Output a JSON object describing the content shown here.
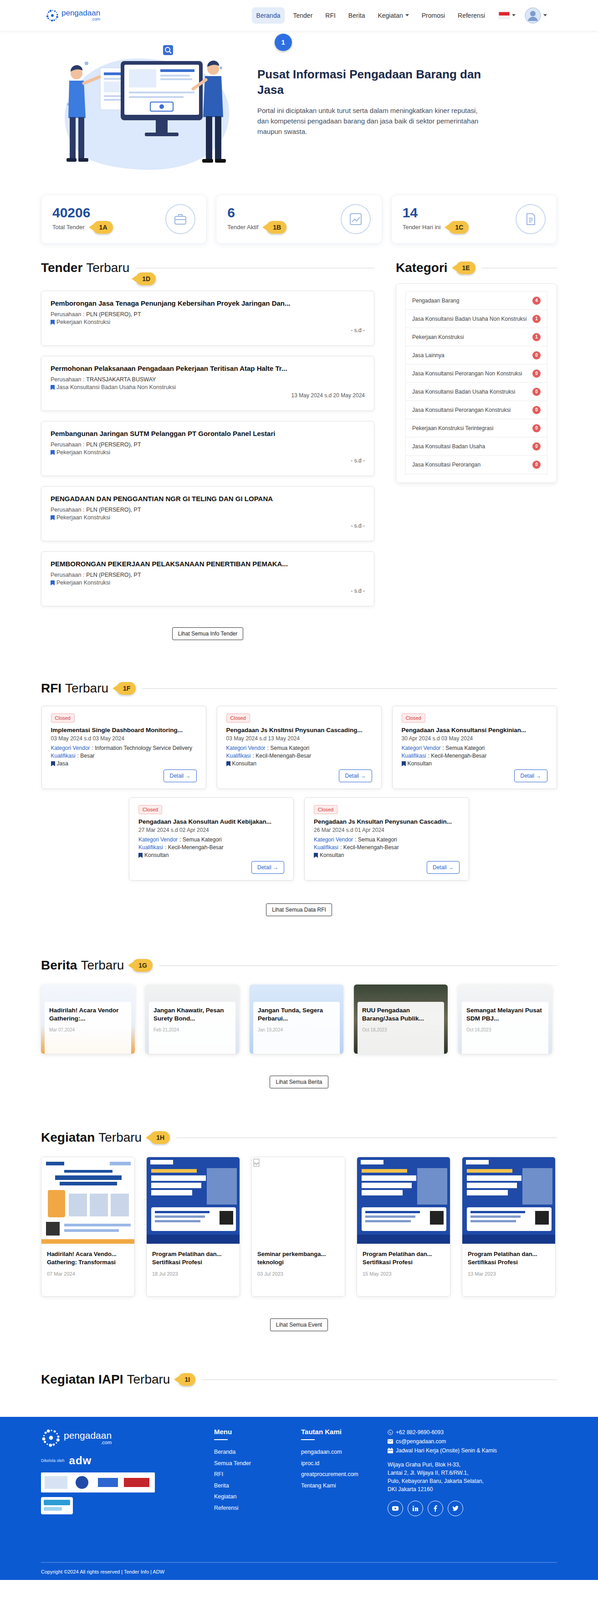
{
  "header": {
    "logo": {
      "name": "pengadaan",
      "suffix": ".com"
    },
    "nav": [
      {
        "label": "Beranda",
        "selected": true
      },
      {
        "label": "Tender",
        "selected": false
      },
      {
        "label": "RFI",
        "selected": false
      },
      {
        "label": "Berita",
        "selected": false
      },
      {
        "label": "Kegiatan",
        "selected": false,
        "dropdown": true
      },
      {
        "label": "Promosi",
        "selected": false
      },
      {
        "label": "Referensi",
        "selected": false
      }
    ],
    "annotation": "1"
  },
  "hero": {
    "title": "Pusat Informasi Pengadaan Barang dan Jasa",
    "description": "Portal ini diciptakan untuk turut serta dalam meningkatkan kiner reputasi, dan kompetensi pengadaan barang dan jasa baik di sektor pemerintahan maupun swasta."
  },
  "stats": [
    {
      "value": "40206",
      "label": "Total Tender",
      "annotation": "1A"
    },
    {
      "value": "6",
      "label": "Tender Aktif",
      "annotation": "1B"
    },
    {
      "value": "14",
      "label": "Tender Hari ini",
      "annotation": "1C"
    }
  ],
  "tenders": {
    "heading": {
      "bold": "Tender",
      "rest": "Terbaru"
    },
    "annotation": "1D",
    "items": [
      {
        "title": "Pemborongan Jasa Tenaga Penunjang Kebersihan Proyek Jaringan Dan...",
        "company_label": "Perusahaan :",
        "company": "PLN (PERSERO), PT",
        "category": "Pekerjaan Konstruksi",
        "period": "- s.d -"
      },
      {
        "title": "Permohonan Pelaksanaan Pengadaan Pekerjaan Teritisan Atap Halte Tr...",
        "company_label": "Perusahaan :",
        "company": "TRANSJAKARTA BUSWAY",
        "category": "Jasa Konsultansi Badan Usaha Non Konstruksi",
        "period": "13 May 2024 s.d 20 May 2024"
      },
      {
        "title": "Pembangunan Jaringan SUTM Pelanggan PT Gorontalo Panel Lestari",
        "company_label": "Perusahaan :",
        "company": "PLN (PERSERO), PT",
        "category": "Pekerjaan Konstruksi",
        "period": "- s.d -"
      },
      {
        "title": "PENGADAAN DAN PENGGANTIAN NGR GI TELING DAN GI LOPANA",
        "company_label": "Perusahaan :",
        "company": "PLN (PERSERO), PT",
        "category": "Pekerjaan Konstruksi",
        "period": "- s.d -"
      },
      {
        "title": "PEMBORONGAN PEKERJAAN PELAKSANAAN PENERTIBAN PEMAKA...",
        "company_label": "Perusahaan :",
        "company": "PLN (PERSERO), PT",
        "category": "Pekerjaan Konstruksi",
        "period": "- s.d -"
      }
    ],
    "button": "Lihat Semua Info Tender"
  },
  "categories": {
    "heading": {
      "bold": "Kategori"
    },
    "annotation": "1E",
    "items": [
      {
        "label": "Pengadaan Barang",
        "count": "4"
      },
      {
        "label": "Jasa Konsultansi Badan Usaha Non Konstruksi",
        "count": "1"
      },
      {
        "label": "Pekerjaan Konstruksi",
        "count": "1"
      },
      {
        "label": "Jasa Lainnya",
        "count": "0"
      },
      {
        "label": "Jasa Konsultansi Perorangan Non Konstruksi",
        "count": "0"
      },
      {
        "label": "Jasa Konsultansi Badan Usaha Konstruksi",
        "count": "0"
      },
      {
        "label": "Jasa Konsultansi Perorangan Konstruksi",
        "count": "0"
      },
      {
        "label": "Pekerjaan Konstruksi Terintegrasi",
        "count": "0"
      },
      {
        "label": "Jasa Konsultasi Badan Usaha",
        "count": "0"
      },
      {
        "label": "Jasa Konsultasi Perorangan",
        "count": "0"
      }
    ]
  },
  "rfi": {
    "heading": {
      "bold": "RFI",
      "rest": "Terbaru"
    },
    "annotation": "1F",
    "items": [
      {
        "status": "Closed",
        "title": "Implementasi Single Dashboard Monitoring...",
        "period": "03 May 2024 s.d 03 May 2024",
        "vendor_label": "Kategori Vendor",
        "vendor": ": Information Technology Service Delivery",
        "qual_label": "Kualifikasi",
        "qual": ": Besar",
        "type": "Jasa",
        "detail": "Detail →"
      },
      {
        "status": "Closed",
        "title": "Pengadaan Js Knsltnsi Pnysunan Cascading...",
        "period": "03 May 2024 s.d 13 May 2024",
        "vendor_label": "Kategori Vendor",
        "vendor": ": Semua Kategori",
        "qual_label": "Kualifikasi",
        "qual": ": Kecil-Menengah-Besar",
        "type": "Konsultan",
        "detail": "Detail →"
      },
      {
        "status": "Closed",
        "title": "Pengadaan Jasa Konsultansi Pengkinian...",
        "period": "30 Apr 2024 s.d 03 May 2024",
        "vendor_label": "Kategori Vendor",
        "vendor": ": Semua Kategori",
        "qual_label": "Kualifikasi",
        "qual": ": Kecil-Menengah-Besar",
        "type": "Konsultan",
        "detail": "Detail →"
      },
      {
        "status": "Closed",
        "title": "Pengadaan Jasa Konsultan Audit Kebijakan...",
        "period": "27 Mar 2024 s.d 02 Apr 2024",
        "vendor_label": "Kategori Vendor",
        "vendor": ": Semua Kategori",
        "qual_label": "Kualifikasi",
        "qual": ": Kecil-Menengah-Besar",
        "type": "Konsultan",
        "detail": "Detail →"
      },
      {
        "status": "Closed",
        "title": "Pengadaan Js Knsultan Penysunan Cascadin...",
        "period": "26 Mar 2024 s.d 01 Apr 2024",
        "vendor_label": "Kategori Vendor",
        "vendor": ": Semua Kategori",
        "qual_label": "Kualifikasi",
        "qual": ": Kecil-Menengah-Besar",
        "type": "Konsultan",
        "detail": "Detail →"
      }
    ],
    "button": "Lihat Semua Data RFI"
  },
  "news": {
    "heading": {
      "bold": "Berita",
      "rest": "Terbaru"
    },
    "annotation": "1G",
    "items": [
      {
        "title": "Hadirilah! Acara Vendor Gathering:...",
        "date": "Mar 07,2024"
      },
      {
        "title": "Jangan Khawatir, Pesan Surety Bond...",
        "date": "Feb 21,2024"
      },
      {
        "title": "Jangan Tunda, Segera Perbarui...",
        "date": "Jan 19,2024"
      },
      {
        "title": "RUU Pengadaan Barang/Jasa Publik...",
        "date": "Oct 18,2023"
      },
      {
        "title": "Semangat Melayani Pusat SDM PBJ...",
        "date": "Oct 16,2023"
      }
    ],
    "button": "Lihat Semua Berita"
  },
  "events": {
    "heading": {
      "bold": "Kegiatan",
      "rest": "Terbaru"
    },
    "annotation": "1H",
    "items": [
      {
        "title_lines": [
          "Hadirilah! Acara Vendo...",
          "Gathering: Transformasi"
        ],
        "date": "07 Mar 2024",
        "broken_image": false
      },
      {
        "title_lines": [
          "Program Pelatihan dan...",
          "Sertifikasi Profesi"
        ],
        "date": "18 Jul 2023",
        "broken_image": false
      },
      {
        "title_lines": [
          "Seminar perkembanga...",
          "teknologi"
        ],
        "date": "03 Jul 2023",
        "broken_image": true
      },
      {
        "title_lines": [
          "Program Pelatihan dan...",
          "Sertifikasi Profesi"
        ],
        "date": "15 May 2023",
        "broken_image": false
      },
      {
        "title_lines": [
          "Program Pelatihan dan...",
          "Sertifikasi Profesi"
        ],
        "date": "13 Mar 2023",
        "broken_image": false
      }
    ],
    "button": "Lihat Semua Event"
  },
  "iapi": {
    "heading": {
      "bold": "Kegiatan IAPI",
      "rest": "Terbaru"
    },
    "annotation": "1I"
  },
  "footer": {
    "logo": {
      "name": "pengadaan",
      "suffix": ".com"
    },
    "managed_by": "Dikelola oleh",
    "manager": "adw",
    "menu": {
      "heading": "Menu",
      "links": [
        "Beranda",
        "Semua Tender",
        "RFI",
        "Berita",
        "Kegiatan",
        "Referensi"
      ]
    },
    "links": {
      "heading": "Tautan Kami",
      "items": [
        "pengadaan.com",
        "iproc.id",
        "greatprocurement.com",
        "Tentang Kami"
      ]
    },
    "contact": {
      "phone": "+62 882-9690-6093",
      "email": "cs@pengadaan.com",
      "schedule": "Jadwal Hari Kerja (Onsite) Senin & Kamis",
      "address": [
        "Wijaya Graha Puri, Blok H-33,",
        "Lantai 2, Jl. Wijaya II, RT.6/RW.1,",
        "Pulo, Kebayoran Baru, Jakarta Selatan,",
        "DKI Jakarta 12160"
      ]
    },
    "copyright": "Copyright ©2024 All rights reserved | Tender Info | ADW"
  }
}
